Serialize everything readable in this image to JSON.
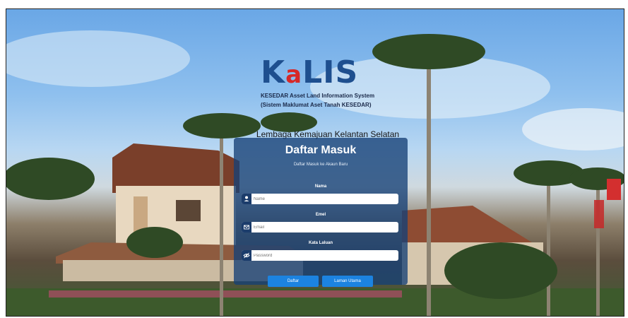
{
  "logo": {
    "word_k": "K",
    "word_a": "a",
    "word_rest": "LIS",
    "subtitle_line1": "KESEDAR Asset Land Information System",
    "subtitle_line2": "(Sistem Maklumat Aset Tanah KESEDAR)"
  },
  "organization": "Lembaga Kemajuan Kelantan Selatan",
  "login": {
    "title": "Daftar Masuk",
    "subtitle": "Daftar Masuk ke Akaun Baru",
    "fields": [
      {
        "label": "Nama",
        "placeholder": "Name",
        "icon": "user-icon"
      },
      {
        "label": "Emel",
        "placeholder": "Email",
        "icon": "mail-icon"
      },
      {
        "label": "Kata Laluan",
        "placeholder": "Password",
        "icon": "eye-slash-icon"
      }
    ],
    "buttons": {
      "register": "Daftar",
      "home": "Laman Utama"
    }
  },
  "colors": {
    "panel": "#164076",
    "button": "#1c83e0",
    "logo_blue": "#1e4f8f",
    "logo_red": "#d62828"
  }
}
